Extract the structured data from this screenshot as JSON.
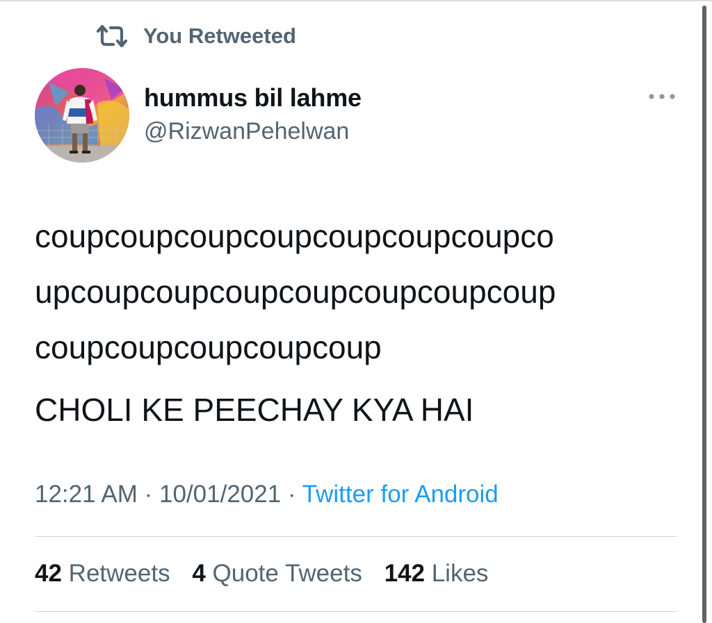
{
  "retweet": {
    "label": "You Retweeted",
    "icon": "retweet-icon"
  },
  "author": {
    "name": "hummus bil lahme",
    "handle": "@RizwanPehelwan",
    "avatar_icon": "avatar-photo"
  },
  "more_icon": "more-horizontal-icon",
  "tweet": {
    "lines": [
      "coupcoupcoupcoupcoupcoupcoupco",
      "upcoupcoupcoupcoupcoupcoupcoup",
      "coupcoupcoupcoupcoup"
    ],
    "line2": "CHOLI KE PEECHAY KYA HAI"
  },
  "meta": {
    "time": "12:21 AM",
    "separator": "·",
    "date": "10/01/2021",
    "source": "Twitter for Android"
  },
  "stats": {
    "retweets_count": "42",
    "retweets_label": "Retweets",
    "quotes_count": "4",
    "quotes_label": "Quote Tweets",
    "likes_count": "142",
    "likes_label": "Likes"
  },
  "colors": {
    "text_primary": "#0f1419",
    "text_secondary": "#536471",
    "link": "#1d9bf0",
    "divider": "#cfd9de"
  }
}
